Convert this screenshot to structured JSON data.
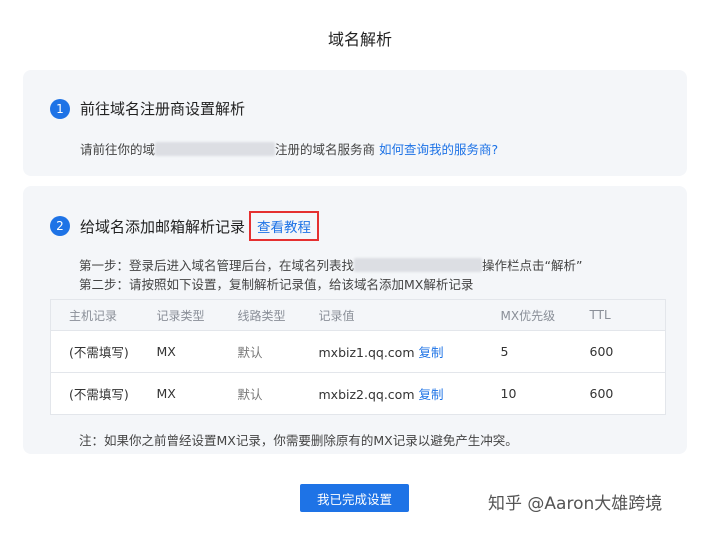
{
  "title": "域名解析",
  "step1": {
    "number": "1",
    "heading": "前往域名注册商设置解析",
    "text_before": "请前往你的域",
    "text_after": "注册的域名服务商",
    "link": "如何查询我的服务商?"
  },
  "step2": {
    "number": "2",
    "heading": "给域名添加邮箱解析记录",
    "tutorial_link": "查看教程",
    "line1_before": "第一步：登录后进入域名管理后台，在域名列表找",
    "line1_after": "操作栏点击“解析”",
    "line2_before": "第二步：请按照如下设置，复制解析记录值，给该域名添加",
    "line2_after": "MX解析记录",
    "table": {
      "headers": [
        "主机记录",
        "记录类型",
        "线路类型",
        "记录值",
        "MX优先级",
        "TTL"
      ],
      "rows": [
        {
          "host": "(不需填写)",
          "type": "MX",
          "line": "默认",
          "value": "mxbiz1.qq.com",
          "copy": "复制",
          "priority": "5",
          "ttl": "600"
        },
        {
          "host": "(不需填写)",
          "type": "MX",
          "line": "默认",
          "value": "mxbiz2.qq.com",
          "copy": "复制",
          "priority": "10",
          "ttl": "600"
        }
      ]
    },
    "note": "注：如果你之前曾经设置MX记录，你需要删除原有的MX记录以避免产生冲突。"
  },
  "done_button": "我已完成设置",
  "watermarks": {
    "corner": "知乎 @Aaron大雄跨境"
  }
}
